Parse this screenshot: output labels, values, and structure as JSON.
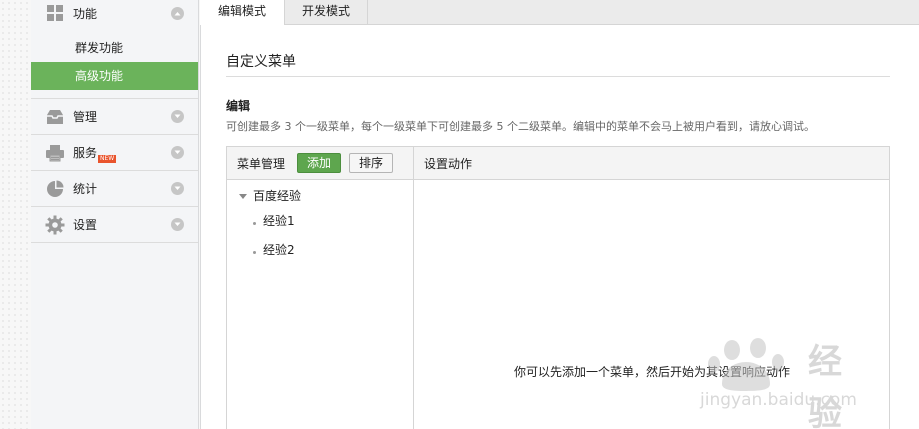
{
  "sidebar": {
    "groups": [
      {
        "label": "功能",
        "icon": "grid-icon",
        "items": [
          "群发功能",
          "高级功能"
        ],
        "active_item": "高级功能"
      },
      {
        "label": "管理",
        "icon": "inbox-icon"
      },
      {
        "label": "服务",
        "icon": "printer-icon",
        "badge": "NEW"
      },
      {
        "label": "统计",
        "icon": "pie-chart-icon"
      },
      {
        "label": "设置",
        "icon": "gear-icon"
      }
    ]
  },
  "tabs": [
    {
      "label": "编辑模式",
      "active": true
    },
    {
      "label": "开发模式",
      "active": false
    }
  ],
  "main": {
    "title": "自定义菜单",
    "section_title": "编辑",
    "section_desc": "可创建最多 3 个一级菜单，每个一级菜单下可创建最多 5 个二级菜单。编辑中的菜单不会马上被用户看到，请放心调试。"
  },
  "menu_panel": {
    "header": "菜单管理",
    "add_label": "添加",
    "sort_label": "排序",
    "tree": {
      "root": "百度经验",
      "children": [
        "经验1",
        "经验2"
      ]
    }
  },
  "action_panel": {
    "header": "设置动作",
    "empty_hint": "你可以先添加一个菜单，然后开始为其设置响应动作"
  },
  "watermark": {
    "text": "经验",
    "url": "jingyan.baidu.com"
  },
  "colors": {
    "accent_green": "#6bb35b",
    "badge_red": "#e9542d"
  }
}
